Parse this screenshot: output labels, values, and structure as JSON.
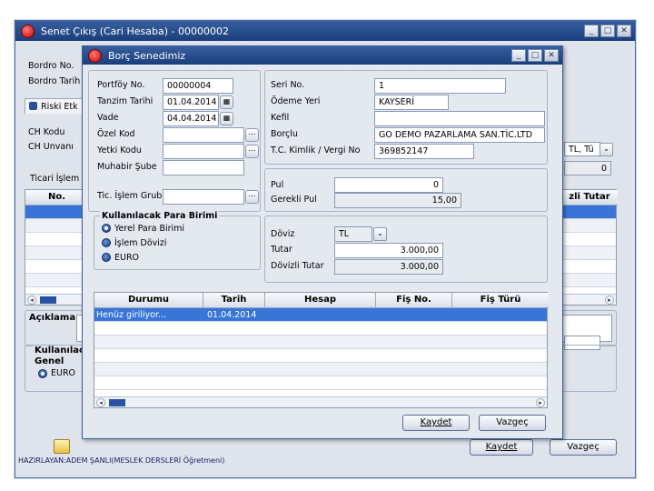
{
  "back": {
    "title": "Senet Çıkış (Cari Hesaba) - 00000002",
    "labels": {
      "bordro_no": "Bordro No.",
      "bordro_tarih": "Bordro Tarih",
      "riski_etk": "Riski Etk",
      "ch_kodu": "CH Kodu",
      "ch_unvani": "CH Unvanı",
      "ticari_islem": "Ticari İşlem",
      "aciklama": "Açıklama",
      "kullanilacak": "Kullanılacak",
      "genel": "Genel",
      "euro": "EURO",
      "currency_combo": "TL, Tü",
      "zero_value": "0"
    },
    "grid": {
      "col_no": "No.",
      "col_tutar": "zli Tutar"
    },
    "buttons": {
      "kaydet": "Kaydet",
      "vazgec": "Vazgeç"
    }
  },
  "dialog": {
    "title": "Borç Senedimiz",
    "left_fields": [
      {
        "label": "Portföy No.",
        "value": "00000004"
      },
      {
        "label": "Tanzim Tarihi",
        "value": "01.04.2014"
      },
      {
        "label": "Vade",
        "value": "04.04.2014"
      },
      {
        "label": "Özel Kod",
        "value": ""
      },
      {
        "label": "Yetki Kodu",
        "value": ""
      },
      {
        "label": "Muhabir Şube",
        "value": ""
      }
    ],
    "tic_islem_grubu": {
      "label": "Tic. İşlem Grub",
      "value": ""
    },
    "right_fields": [
      {
        "label": "Seri No.",
        "value": "1"
      },
      {
        "label": "Ödeme Yeri",
        "value": "KAYSERİ"
      },
      {
        "label": "Kefil",
        "value": ""
      },
      {
        "label": "Borçlu",
        "value": "GO DEMO PAZARLAMA SAN.TİC.LTD"
      },
      {
        "label": "T.C. Kimlik / Vergi No",
        "value": "369852147"
      }
    ],
    "currency_group": {
      "title": "Kullanılacak Para Birimi",
      "options": [
        "Yerel Para Birimi",
        "İşlem Dövizi",
        "EURO"
      ],
      "selected": "Yerel Para Birimi"
    },
    "pul": {
      "label": "Pul",
      "value": "0"
    },
    "gerekli_pul": {
      "label": "Gerekli Pul",
      "value": "15,00"
    },
    "doviz": {
      "label": "Döviz",
      "value": "TL"
    },
    "tutar": {
      "label": "Tutar",
      "value": "3.000,00"
    },
    "dovizli_tutar": {
      "label": "Dövizli Tutar",
      "value": "3.000,00"
    },
    "table": {
      "columns": [
        "Durumu",
        "Tarih",
        "Hesap",
        "Fiş No.",
        "Fiş Türü"
      ],
      "rows": [
        {
          "durumu": "Henüz giriliyor...",
          "tarih": "01.04.2014",
          "hesap": "",
          "fis_no": "",
          "fis_turu": ""
        }
      ]
    },
    "buttons": {
      "kaydet": "Kaydet",
      "vazgec": "Vazgeç"
    }
  },
  "footer": "HAZIRLAYAN:ADEM ŞANLI(MESLEK DERSLERİ Öğretmeni)",
  "colors": {
    "titlebar": "#1a3e7c",
    "selection": "#3875d7",
    "window_bg": "#e4e8ef"
  }
}
